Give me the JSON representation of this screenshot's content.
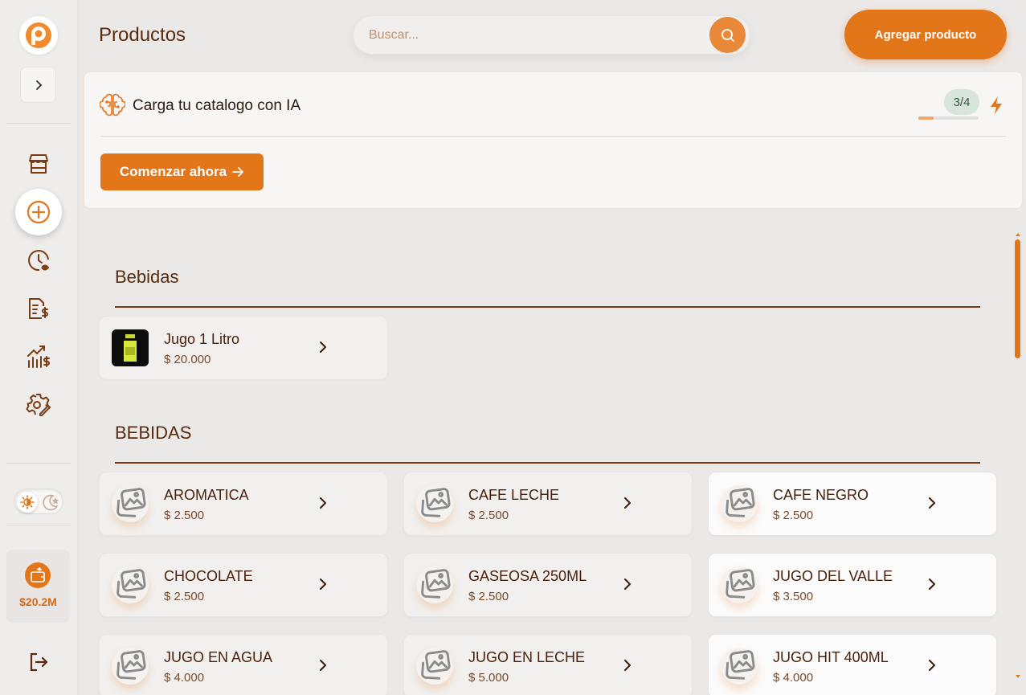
{
  "app": {
    "brand_color": "#e4761a",
    "logo_icon": "brand-p-logo"
  },
  "sidebar": {
    "nav": [
      {
        "id": "store",
        "icon": "storefront-icon"
      },
      {
        "id": "add",
        "icon": "plus-circle-icon",
        "active": true
      },
      {
        "id": "history",
        "icon": "clock-history-icon"
      },
      {
        "id": "invoices",
        "icon": "receipt-dollar-icon"
      },
      {
        "id": "stats",
        "icon": "chart-dollar-icon"
      },
      {
        "id": "settings",
        "icon": "gear-edit-icon"
      }
    ],
    "wallet_value": "$20.2M"
  },
  "header": {
    "title": "Productos",
    "search_placeholder": "Buscar...",
    "add_button": "Agregar producto"
  },
  "ai_card": {
    "title": "Carga tu catalogo con IA",
    "step": "3/4",
    "progress": 0.25,
    "cta": "Comenzar ahora"
  },
  "sections": [
    {
      "title": "Bebidas",
      "products": [
        {
          "name": "Jugo 1 Litro",
          "price": "$ 20.000",
          "image": "photo"
        }
      ]
    },
    {
      "title": "BEBIDAS",
      "products": [
        {
          "name": "AROMATICA",
          "price": "$ 2.500"
        },
        {
          "name": "CAFE LECHE",
          "price": "$ 2.500"
        },
        {
          "name": "CAFE NEGRO",
          "price": "$ 2.500"
        },
        {
          "name": "CHOCOLATE",
          "price": "$ 2.500"
        },
        {
          "name": "GASEOSA 250ML",
          "price": "$ 2.500"
        },
        {
          "name": "JUGO DEL VALLE",
          "price": "$ 3.500"
        },
        {
          "name": "JUGO EN AGUA",
          "price": "$ 4.000"
        },
        {
          "name": "JUGO EN LECHE",
          "price": "$ 5.000"
        },
        {
          "name": "JUGO HIT 400ML",
          "price": "$ 4.000"
        }
      ]
    }
  ]
}
